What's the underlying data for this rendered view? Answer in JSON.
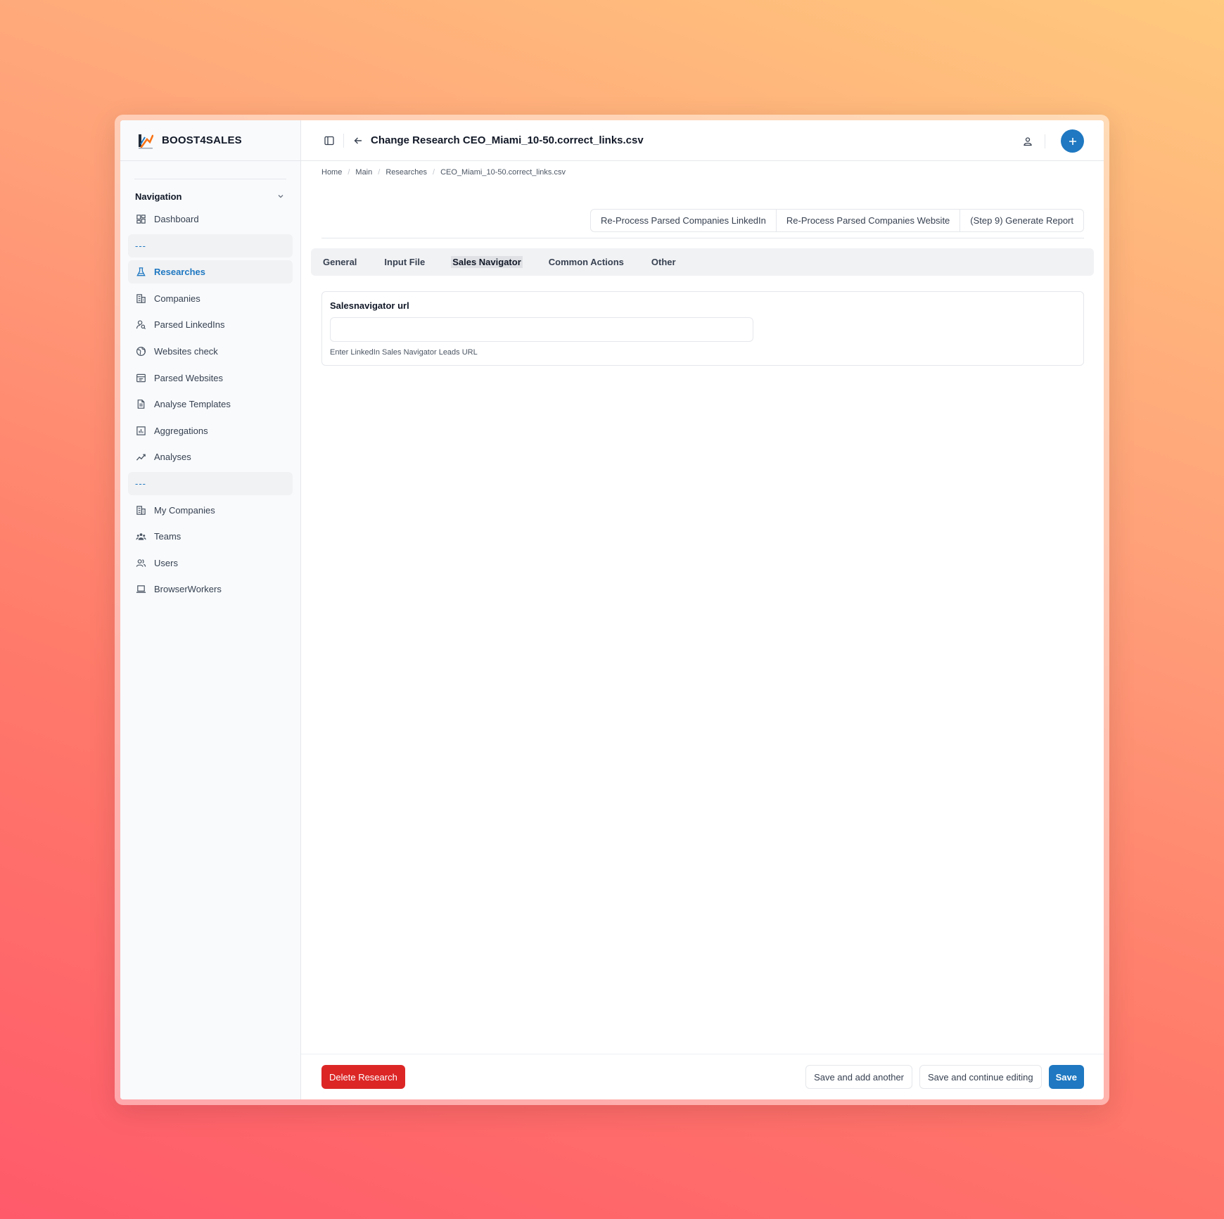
{
  "brand": {
    "name": "BOOST4SALES"
  },
  "navigation": {
    "header": "Navigation",
    "items": [
      {
        "label": "Dashboard",
        "icon": "dashboard-icon"
      },
      {
        "label": "---",
        "divider": true
      },
      {
        "label": "Researches",
        "icon": "flask-icon",
        "active": true
      },
      {
        "label": "Companies",
        "icon": "building-icon"
      },
      {
        "label": "Parsed LinkedIns",
        "icon": "user-search-icon"
      },
      {
        "label": "Websites check",
        "icon": "globe-icon"
      },
      {
        "label": "Parsed Websites",
        "icon": "browser-window-icon"
      },
      {
        "label": "Analyse Templates",
        "icon": "document-icon"
      },
      {
        "label": "Aggregations",
        "icon": "bar-chart-icon"
      },
      {
        "label": "Analyses",
        "icon": "trend-icon"
      },
      {
        "label": "---",
        "divider": true
      },
      {
        "label": "My Companies",
        "icon": "building-icon"
      },
      {
        "label": "Teams",
        "icon": "team-icon"
      },
      {
        "label": "Users",
        "icon": "users-icon"
      },
      {
        "label": "BrowserWorkers",
        "icon": "laptop-icon"
      }
    ]
  },
  "header": {
    "title": "Change Research CEO_Miami_10-50.correct_links.csv"
  },
  "breadcrumb": [
    "Home",
    "Main",
    "Researches",
    "CEO_Miami_10-50.correct_links.csv"
  ],
  "object_actions": [
    "Re-Process Parsed Companies LinkedIn",
    "Re-Process Parsed Companies Website",
    "(Step 9) Generate Report"
  ],
  "tabs": [
    {
      "label": "General"
    },
    {
      "label": "Input File"
    },
    {
      "label": "Sales Navigator",
      "active": true
    },
    {
      "label": "Common Actions"
    },
    {
      "label": "Other"
    }
  ],
  "form": {
    "salesnavigator": {
      "label": "Salesnavigator url",
      "value": "",
      "help": "Enter LinkedIn Sales Navigator Leads URL"
    }
  },
  "footer": {
    "delete_label": "Delete Research",
    "save_add_label": "Save and add another",
    "save_continue_label": "Save and continue editing",
    "save_label": "Save"
  },
  "colors": {
    "accent": "#1f78c1",
    "danger": "#dc2626",
    "sidebar_bg": "#f8fafc"
  }
}
